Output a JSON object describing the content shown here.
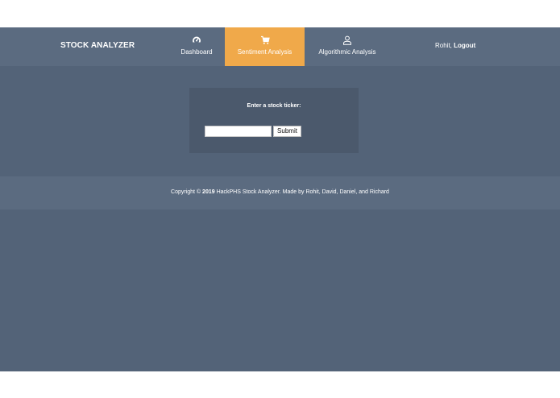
{
  "navbar": {
    "brand": "STOCK ANALYZER",
    "items": [
      {
        "label": "Dashboard",
        "icon": "speedometer-icon",
        "active": false
      },
      {
        "label": "Sentiment Analysis",
        "icon": "shopping-cart-icon",
        "active": true
      },
      {
        "label": "Algorithmic Analysis",
        "icon": "user-icon",
        "active": false
      }
    ],
    "user": {
      "name": "Rohit,",
      "logout": "Logout"
    }
  },
  "form": {
    "title": "Enter a stock ticker:",
    "input_value": "",
    "input_placeholder": "",
    "submit_label": "Submit"
  },
  "footer": {
    "prefix": "Copyright © ",
    "year": "2019",
    "suffix": " HackPHS Stock Analyzer. Made by Rohit, David, Daniel, and Richard"
  },
  "colors": {
    "background": "#536378",
    "navbar": "#5b6b80",
    "active_tab": "#f0a94a",
    "card": "#4b596c"
  }
}
